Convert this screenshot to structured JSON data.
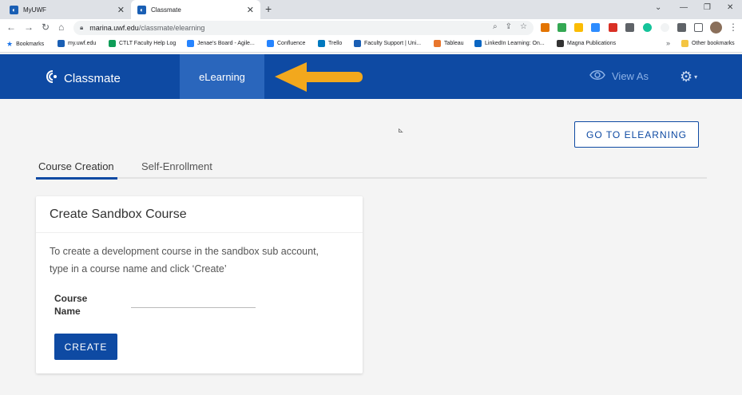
{
  "browser": {
    "tabs": [
      {
        "title": "MyUWF",
        "favicon": "uwf-icon",
        "active": false
      },
      {
        "title": "Classmate",
        "favicon": "uwf-icon",
        "active": true
      }
    ],
    "url_host": "marina.uwf.edu",
    "url_path": "/classmate/elearning",
    "bookmarks": [
      {
        "label": "Bookmarks",
        "icon": "star-icon",
        "color": "#1a73e8"
      },
      {
        "label": "my.uwf.edu",
        "icon": "uwf-icon",
        "color": "#1a5fb4"
      },
      {
        "label": "CTLT Faculty Help Log",
        "icon": "sheets-icon",
        "color": "#0f9d58"
      },
      {
        "label": "Jenae's Board - Agile...",
        "icon": "jira-icon",
        "color": "#2684ff"
      },
      {
        "label": "Confluence",
        "icon": "confluence-icon",
        "color": "#2684ff"
      },
      {
        "label": "Trello",
        "icon": "trello-icon",
        "color": "#0079bf"
      },
      {
        "label": "Faculty Support | Uni...",
        "icon": "uwf-icon",
        "color": "#1a5fb4"
      },
      {
        "label": "Tableau",
        "icon": "tableau-icon",
        "color": "#e8762d"
      },
      {
        "label": "LinkedIn Learning: On...",
        "icon": "linkedin-icon",
        "color": "#0a66c2"
      },
      {
        "label": "Magna Publications",
        "icon": "magna-icon",
        "color": "#333333"
      },
      {
        "label": "Other bookmarks",
        "icon": "folder-icon",
        "color": "#f4c542"
      }
    ],
    "bookmarks_more": "»"
  },
  "app": {
    "brand": "Classmate",
    "nav_active": "eLearning",
    "view_as": "View As",
    "accent": "#0e4aa3",
    "arrow_color": "#f2a81d"
  },
  "page": {
    "goto_button": "GO TO ELEARNING",
    "tabs": [
      "Course Creation",
      "Self-Enrollment"
    ],
    "card": {
      "title": "Create Sandbox Course",
      "description": "To create a development course in the sandbox sub account, type in a course name and click ‘Create’",
      "field_label": "Course Name",
      "field_value": "",
      "create_button": "CREATE"
    }
  }
}
